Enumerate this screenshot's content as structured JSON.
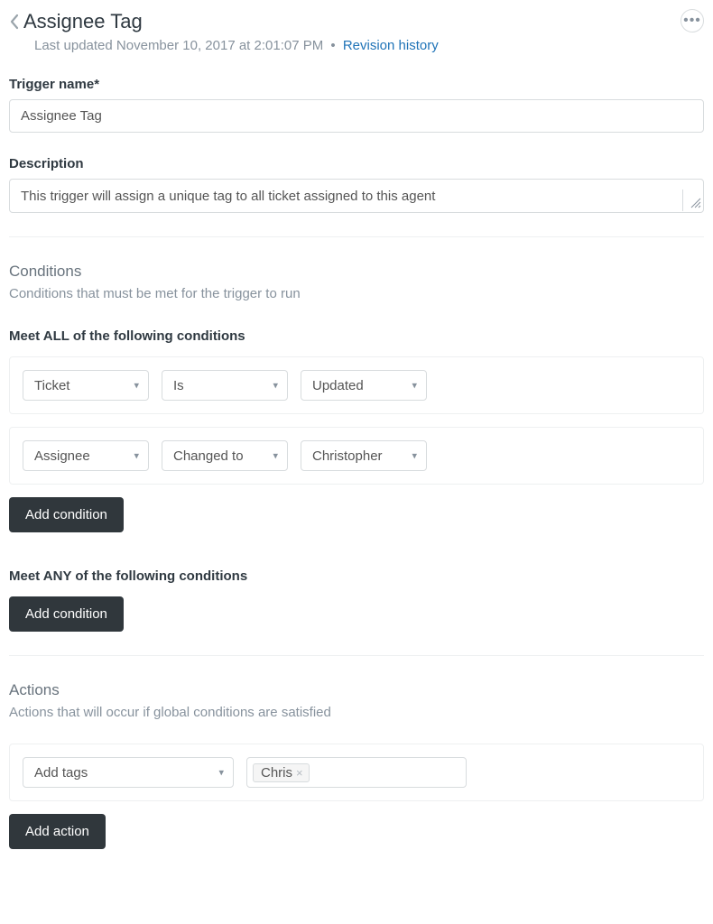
{
  "header": {
    "title": "Assignee Tag",
    "last_updated_prefix": "Last updated ",
    "last_updated": "November 10, 2017 at 2:01:07 PM",
    "revision_link": "Revision history"
  },
  "form": {
    "trigger_name_label": "Trigger name*",
    "trigger_name_value": "Assignee Tag",
    "description_label": "Description",
    "description_value": "This trigger will assign a unique tag to all ticket assigned to this agent"
  },
  "conditions": {
    "section_title": "Conditions",
    "section_sub": "Conditions that must be met for the trigger to run",
    "all_heading": "Meet ALL of the following conditions",
    "any_heading": "Meet ANY of the following conditions",
    "rows_all": [
      {
        "field": "Ticket",
        "operator": "Is",
        "value": "Updated"
      },
      {
        "field": "Assignee",
        "operator": "Changed to",
        "value": "Christopher"
      }
    ],
    "add_condition_label": "Add condition"
  },
  "actions": {
    "section_title": "Actions",
    "section_sub": "Actions that will occur if global conditions are satisfied",
    "rows": [
      {
        "field": "Add tags",
        "tag": "Chris"
      }
    ],
    "add_action_label": "Add action"
  }
}
